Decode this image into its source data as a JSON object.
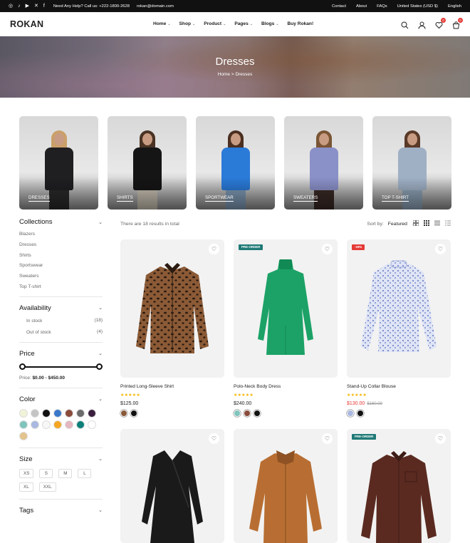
{
  "topbar": {
    "help": "Need Any Help? Call us: +222-1800-2628",
    "email": "rokan@domain.com",
    "links": [
      "Contact",
      "About",
      "FAQs",
      "United States (USD $)",
      "English"
    ]
  },
  "header": {
    "logo": "ROKAN",
    "menu": [
      {
        "label": "Home",
        "dropdown": true
      },
      {
        "label": "Shop",
        "dropdown": true
      },
      {
        "label": "Product",
        "dropdown": true
      },
      {
        "label": "Pages",
        "dropdown": true
      },
      {
        "label": "Blogs",
        "dropdown": true
      },
      {
        "label": "Buy Rokan!",
        "dropdown": false
      }
    ],
    "wishlist_count": "0",
    "cart_count": "0"
  },
  "hero": {
    "title": "Dresses",
    "breadcrumb_home": "Home",
    "breadcrumb_sep": ">",
    "breadcrumb_current": "Dresses"
  },
  "categories": [
    {
      "label": "DRESSES",
      "body": "#1f1f22",
      "legs": "#2a2a2a",
      "hair": "#caa06a"
    },
    {
      "label": "SHIRTS",
      "body": "#151515",
      "legs": "#c9c2b4",
      "hair": "#4a3324"
    },
    {
      "label": "SPORTWEAR",
      "body": "#2a7ad8",
      "legs": "#7f9ab6",
      "hair": "#4b2f20"
    },
    {
      "label": "SWEATERS",
      "body": "#8a90c8",
      "legs": "#3a2a26",
      "hair": "#7a5535"
    },
    {
      "label": "TOP T-SHIRT",
      "body": "#9fb0c4",
      "legs": "#8fa4b8",
      "hair": "#5a3a28"
    }
  ],
  "sidebar": {
    "collections_title": "Collections",
    "collections": [
      "Blazers",
      "Dresses",
      "Shirts",
      "Sportswear",
      "Sweaters",
      "Top T-shirt"
    ],
    "availability_title": "Availability",
    "availability": [
      {
        "label": "In stock",
        "count": "(18)"
      },
      {
        "label": "Out of stock",
        "count": "(4)"
      }
    ],
    "price_title": "Price",
    "price_prefix": "Price:",
    "price_range": "$0.00 - $450.00",
    "color_title": "Color",
    "colors": [
      "#f1f3d8",
      "#c4c4c4",
      "#111111",
      "#3a78c9",
      "#8a4b3a",
      "#6b6b6b",
      "#3a1f3f",
      "#7fc4bd",
      "#a9b8e0",
      "#f7f7f7",
      "#f5a623",
      "#e4b6c0",
      "#0b7f7a",
      "#ffffff",
      "#e3c48d"
    ],
    "size_title": "Size",
    "sizes": [
      "XS",
      "S",
      "M",
      "L",
      "XL",
      "XXL"
    ],
    "tags_title": "Tags"
  },
  "toolbar": {
    "results": "There are 18 results in total",
    "sort_label": "Sort by:",
    "sort_value": "Featured"
  },
  "products": [
    {
      "name": "Printed Long-Sleeve Shirt",
      "price": "$125.00",
      "old_price": "",
      "tag": "",
      "tag_color": "",
      "stars": "★★★★★",
      "swatches": [
        "#8a5a3a",
        "#111111"
      ],
      "img": "shirt",
      "c1": "#8b5a36",
      "c2": "#2a1a10"
    },
    {
      "name": "Polo-Neck Body Dress",
      "price": "$240.00",
      "old_price": "",
      "tag": "PRE-ORDER",
      "tag_color": "#1f7a76",
      "stars": "★★★★★",
      "swatches": [
        "#7fc4bd",
        "#8a4b3a",
        "#111111"
      ],
      "img": "dress",
      "c1": "#1ca267",
      "c2": "#128a55"
    },
    {
      "name": "Stand-Up Collar Blouse",
      "price": "$130.00",
      "old_price": "$160.00",
      "tag": "-19%",
      "tag_color": "#e53935",
      "stars": "★★★★★",
      "swatches": [
        "#a9b8e0",
        "#111111"
      ],
      "img": "blouse",
      "c1": "#dfe4f5",
      "c2": "#5e74c2"
    },
    {
      "name": "",
      "price": "",
      "old_price": "",
      "tag": "",
      "tag_color": "",
      "stars": "",
      "swatches": [],
      "img": "wrap",
      "c1": "#1a1a1a",
      "c2": "#333333"
    },
    {
      "name": "",
      "price": "",
      "old_price": "",
      "tag": "",
      "tag_color": "",
      "stars": "",
      "swatches": [],
      "img": "fleece",
      "c1": "#b86e32",
      "c2": "#8e5224"
    },
    {
      "name": "",
      "price": "",
      "old_price": "",
      "tag": "PRE-ORDER",
      "tag_color": "#1f7a76",
      "stars": "",
      "swatches": [],
      "img": "shirt2",
      "c1": "#5a2a20",
      "c2": "#3e1c16"
    }
  ]
}
